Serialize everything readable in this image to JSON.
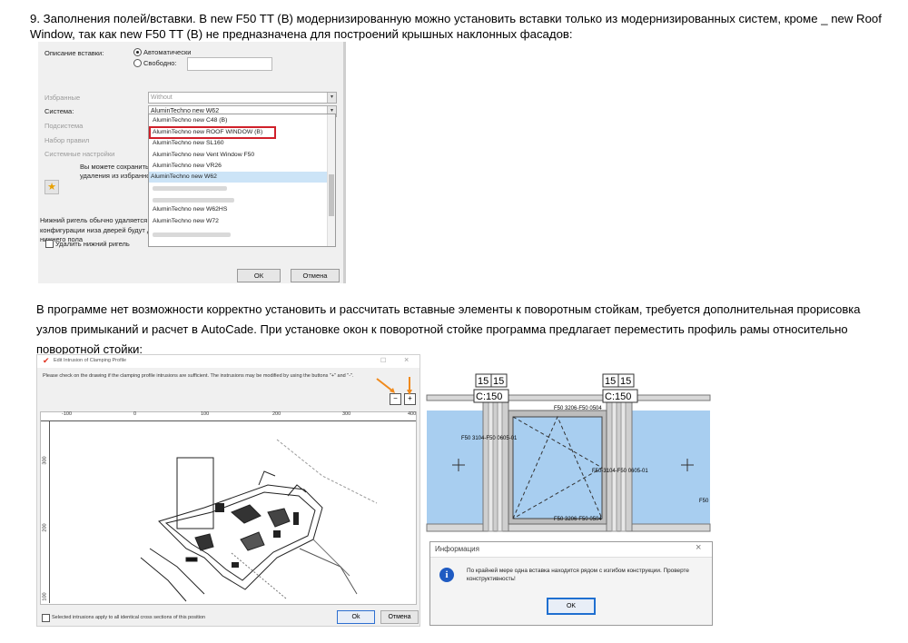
{
  "heading": {
    "line1": "9. Заполнения полей/вставки. В new F50 TT (B) модернизированную можно установить вставки только из модернизированных систем, кроме _ new Roof",
    "line2": "Window, так как new F50 TT (B) не предназначена для построений крышных наклонных фасадов:"
  },
  "dialog1": {
    "insert_desc_label": "Описание вставки:",
    "radio_auto": "Автоматически",
    "radio_free": "Свободно:",
    "favorites_label": "Избранные",
    "favorites_value": "Without",
    "system_label": "Система:",
    "system_value": "AluminTechno new W62",
    "subsystem_label": "Подсистема",
    "ruleset_label": "Набор правил",
    "system_settings_label": "Системные настройки",
    "save_hint_1": "Вы можете сохранить",
    "save_hint_2": "удаления из избранно",
    "lower_rail_hint_1": "Нижний ригель обычно удаляется п",
    "lower_rail_hint_2": "конфигурации низа дверей будут д",
    "lower_rail_hint_3": "нижнего пола",
    "delete_lower_rail": "Удалить нижний ригель",
    "ok_button": "ОК",
    "cancel_button": "Отмена",
    "dropdown_items": [
      "AluminTechno new C48 (B)",
      "AluminTechno new ROOF WINDOW (B)",
      "AluminTechno new SL160",
      "AluminTechno new Vent Window F50",
      "AluminTechno new VR26",
      "AluminTechno new W62",
      "AluminTechno new W62HS",
      "AluminTechno new W72"
    ]
  },
  "paragraph2": {
    "line1": "В программе нет возможности корректно установить и рассчитать вставные элементы к поворотным стойкам, требуется дополнительная прорисовка",
    "line2": "узлов примыканий и расчет в AutoCade. При установке окон к поворотной стойке программа предлагает переместить профиль рамы относительно",
    "line3": "поворотной стойки:"
  },
  "dialog2": {
    "title": "Edit Intrusion of Clamping Profile",
    "instruction": "Please check on the drawing if the clamping profile intrusions are sufficient. The instrusions may be modified by using the buttons \"+\" and \"-\".",
    "minus_label": "−",
    "plus_label": "+",
    "ruler_x": [
      "-100",
      "0",
      "100",
      "200",
      "300",
      "400"
    ],
    "ruler_y": [
      "300",
      "200",
      "100"
    ],
    "apply_all": "Selected intrusions apply to all identical cross sections of this position",
    "ok_button": "Ok",
    "cancel_button": "Отмена"
  },
  "drawing3": {
    "dim_top_left_a": "15",
    "dim_top_left_b": "15",
    "dim_top_right_a": "15",
    "dim_top_right_b": "15",
    "c_left": "C:150",
    "c_right": "C:150",
    "label_left": "F50 3104-F50 0605-01",
    "label_top": "F50 3206-F50 0504",
    "label_right": "F50-3104-F50 0605-01",
    "label_bottom": "F50 3206-F50 0504",
    "label_edge": "F50"
  },
  "dialog4": {
    "title": "Информация",
    "message_1": "По крайней мере одна вставка находится рядом с изгибом конструкции. Проверте",
    "message_2": "конструктивность!",
    "ok_button": "OK",
    "info_glyph": "i"
  },
  "colors": {
    "highlight_red": "#d0202a",
    "selection_blue": "#cce4f7",
    "glass_blue": "#a8cef0",
    "orange_arrow": "#f08a1c",
    "ok_focus_blue": "#1f6fd0"
  }
}
